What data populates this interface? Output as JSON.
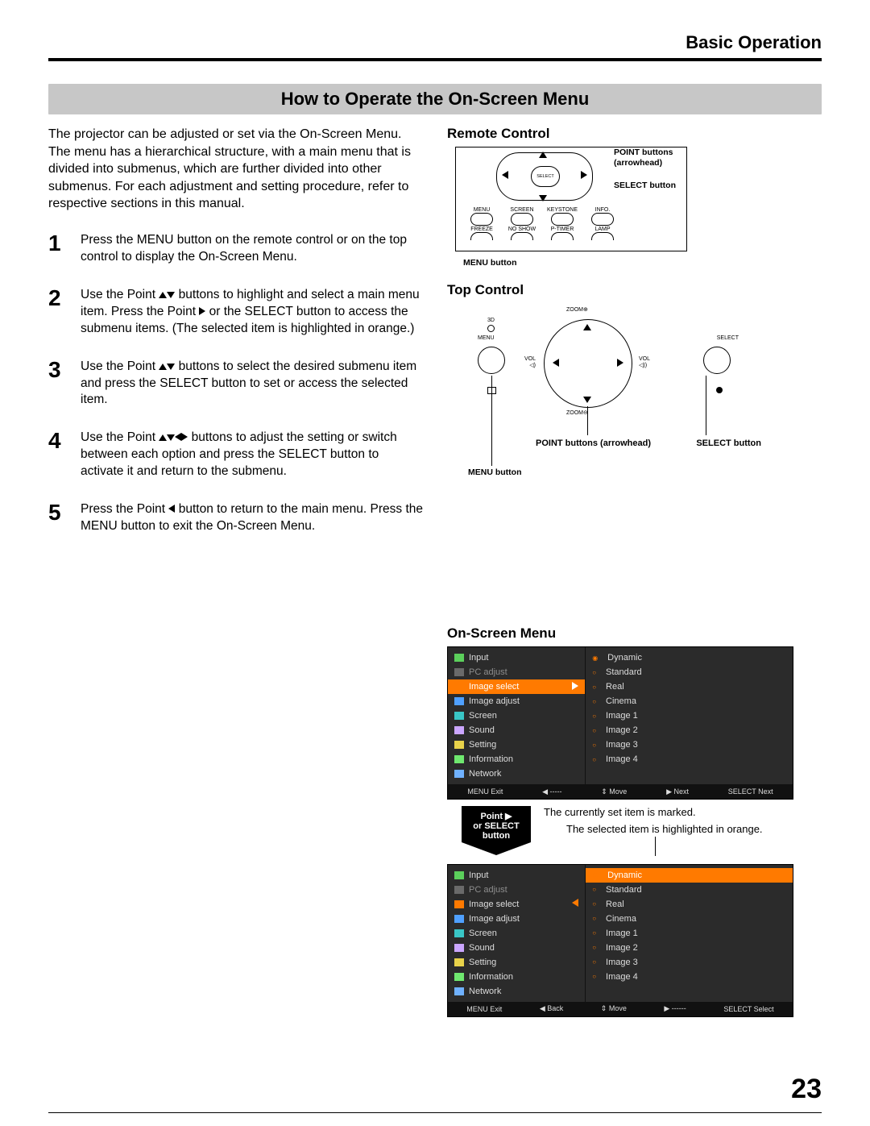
{
  "header": {
    "section": "Basic Operation"
  },
  "title": "How to Operate the On-Screen Menu",
  "intro": "The projector can be adjusted or set via the On-Screen Menu. The menu has a hierarchical structure, with a main menu that is divided into submenus, which are further divided into other submenus. For each adjustment and setting procedure, refer to respective sections in this manual.",
  "steps": [
    {
      "n": "1",
      "text": "Press the MENU button on the remote control or on the top control to display the On-Screen Menu."
    },
    {
      "n": "2",
      "pre": "Use the Point ",
      "mid": " buttons to highlight and select a main menu item. Press the Point ",
      "post": " or the SELECT button to access the submenu items. (The selected item is highlighted in orange.)"
    },
    {
      "n": "3",
      "pre": "Use the Point ",
      "post": " buttons to select the desired submenu item and press the SELECT button to set or access the selected item."
    },
    {
      "n": "4",
      "pre": "Use the Point ",
      "post": " buttons to adjust the setting or switch between each option and press the SELECT button to activate it and return to the submenu."
    },
    {
      "n": "5",
      "pre": "Press the Point ",
      "post": " button to return to the main menu. Press the MENU button to exit the On-Screen Menu."
    }
  ],
  "remote": {
    "heading": "Remote Control",
    "sel": "SELECT",
    "row1": [
      "MENU",
      "SCREEN",
      "KEYSTONE",
      "INFO."
    ],
    "row2": [
      "FREEZE",
      "NO SHOW",
      "P-TIMER",
      "LAMP"
    ],
    "callouts": {
      "point": "POINT buttons (arrowhead)",
      "select": "SELECT button",
      "menu": "MENU button"
    }
  },
  "top": {
    "heading": "Top Control",
    "labels": {
      "3d": "3D",
      "zoomin": "ZOOM⊕",
      "zoomout": "ZOOM⊖",
      "menu": "MENU",
      "select": "SELECT",
      "vol": "VOL"
    },
    "callouts": {
      "point": "POINT buttons (arrowhead)",
      "select": "SELECT button",
      "menu": "MENU button"
    }
  },
  "osm": {
    "heading": "On-Screen Menu",
    "left_items": [
      {
        "ic": "ic-green",
        "label": "Input"
      },
      {
        "ic": "ic-grey",
        "label": "PC adjust",
        "dim": true
      },
      {
        "ic": "ic-orange",
        "label": "Image select",
        "sel": true
      },
      {
        "ic": "ic-blue",
        "label": "Image adjust"
      },
      {
        "ic": "ic-teal",
        "label": "Screen"
      },
      {
        "ic": "ic-lav",
        "label": "Sound"
      },
      {
        "ic": "ic-yel",
        "label": "Setting"
      },
      {
        "ic": "ic-info",
        "label": "Information"
      },
      {
        "ic": "ic-net",
        "label": "Network"
      }
    ],
    "right_items": [
      "Dynamic",
      "Standard",
      "Real",
      "Cinema",
      "Image 1",
      "Image 2",
      "Image 3",
      "Image 4"
    ],
    "footer1": [
      "MENU Exit",
      "◀ -----",
      "⇕ Move",
      "▶ Next",
      "SELECT Next"
    ],
    "footer2": [
      "MENU Exit",
      "◀ Back",
      "⇕ Move",
      "▶ ------",
      "SELECT Select"
    ],
    "arrow_label": "Point ▶\nor SELECT\nbutton",
    "note_marked": "The currently set item is marked.",
    "note_selected": "The selected item is highlighted in orange."
  },
  "page_number": "23"
}
